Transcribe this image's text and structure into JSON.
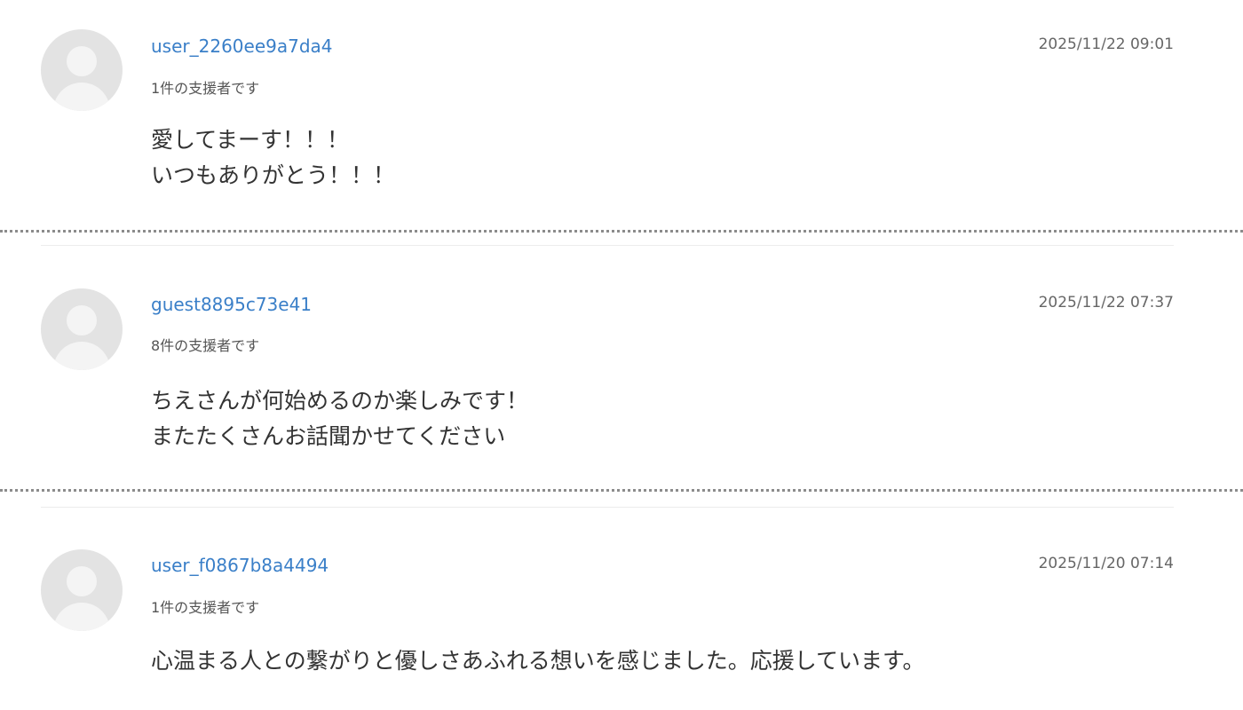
{
  "comments": [
    {
      "username": "user_2260ee9a7da4",
      "supporters": "1件の支援者です",
      "date": "2025/11/22 09:01",
      "message_lines": [
        "愛してまーす！！！",
        "いつもありがとう！！！"
      ]
    },
    {
      "username": "guest8895c73e41",
      "supporters": "8件の支援者です",
      "date": "2025/11/22 07:37",
      "message_lines": [
        "ちえさんが何始めるのか楽しみです！",
        "またたくさんお話聞かせてください"
      ]
    },
    {
      "username": "user_f0867b8a4494",
      "supporters": "1件の支援者です",
      "date": "2025/11/20 07:14",
      "message_lines": [
        "心温まる人との繋がりと優しさあふれる想いを感じました。応援しています。"
      ]
    }
  ],
  "colors": {
    "username": "#3a7fc8",
    "avatar_bg": "#e3e3e3",
    "divider": "#8c8c8c"
  },
  "icons": {
    "avatar": "default-user-avatar-icon"
  }
}
